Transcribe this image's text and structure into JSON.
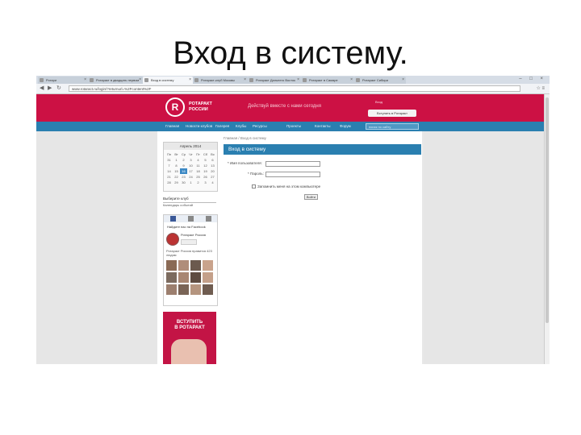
{
  "slide": {
    "title": "Вход в систему."
  },
  "browser": {
    "tabs": [
      {
        "label": "Ротари"
      },
      {
        "label": "Ротаракт в двадцать первом"
      },
      {
        "label": "Вход в систему"
      },
      {
        "label": "Ротаракт-клуб Москвы"
      },
      {
        "label": "Ротаракт Дальнего Восток"
      },
      {
        "label": "Ротаракт в Самаре"
      },
      {
        "label": "Ротаракт Сибири"
      }
    ],
    "url": "www.rotaract.ru/login/?returnurl=%2Fcontent%2F",
    "window_controls": "– □ ×"
  },
  "site": {
    "logo_letter": "R",
    "brand_line1": "РОТАРАКТ",
    "brand_line2": "РОССИИ",
    "slogan": "Действуй вместе с нами сегодня",
    "login_link": "Вход",
    "join_button": "Вступить в Ротаракт",
    "nav": [
      "Главная",
      "Новости клубов",
      "Галерея",
      "Клубы",
      "Ресурсы",
      "Проекты",
      "Контакты",
      "Форум"
    ],
    "search_placeholder": "поиск по сайту"
  },
  "sidebar": {
    "calendar": {
      "month": "Апрель 2014",
      "weekdays": [
        "Пн",
        "Вт",
        "Ср",
        "Чт",
        "Пт",
        "Сб",
        "Вс"
      ],
      "days": [
        "31",
        "1",
        "2",
        "3",
        "4",
        "5",
        "6",
        "7",
        "8",
        "9",
        "10",
        "11",
        "12",
        "13",
        "14",
        "15",
        "16",
        "17",
        "18",
        "19",
        "20",
        "21",
        "22",
        "23",
        "24",
        "25",
        "26",
        "27",
        "28",
        "29",
        "30",
        "1",
        "2",
        "3",
        "4"
      ],
      "today": "16"
    },
    "select_label": "Выберите клуб",
    "links": "Календарь событий",
    "facebook": {
      "title": "Найдите нас на Facebook",
      "page_name": "Ротаракт Россия",
      "like": "Нравится",
      "fans_text": "Ротаракт Россия нравится 423 людям"
    },
    "banner": {
      "line1": "ВСТУПИТЬ",
      "line2": "В РОТАРАКТ"
    }
  },
  "content": {
    "breadcrumb": "Главная / Вход в систему",
    "heading": "Вход в систему",
    "username_label": "* Имя пользователя:",
    "password_label": "* Пароль:",
    "remember_label": "Запомнить меня на этом компьютере",
    "submit_label": "Войти"
  },
  "colors": {
    "header_red": "#cc1144",
    "nav_blue": "#2a7fb0"
  }
}
